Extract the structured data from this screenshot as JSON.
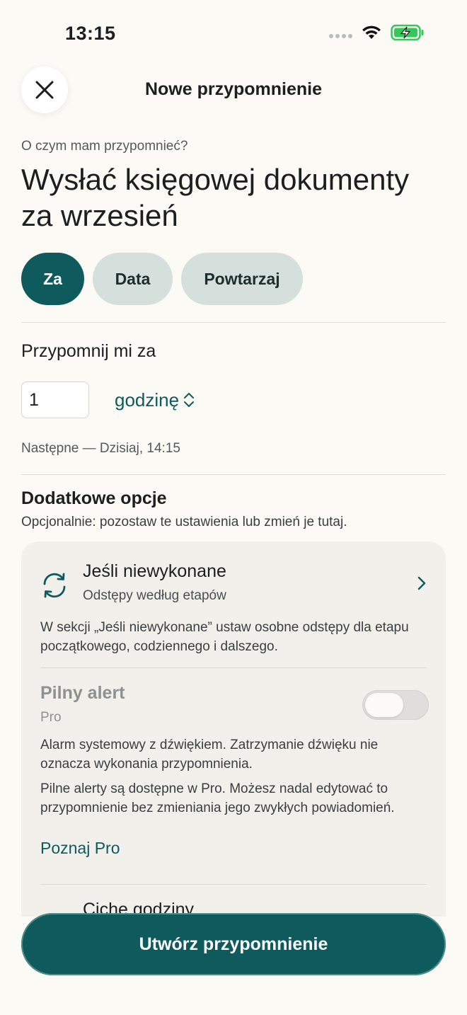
{
  "status_bar": {
    "time": "13:15"
  },
  "header": {
    "title": "Nowe przypomnienie"
  },
  "form": {
    "question_label": "O czym mam przypomnieć?",
    "reminder_text": "Wysłać księgowej dokumenty za wrzesień",
    "segments": [
      {
        "label": "Za",
        "active": true
      },
      {
        "label": "Data",
        "active": false
      },
      {
        "label": "Powtarzaj",
        "active": false
      }
    ],
    "remind_label": "Przypomnij mi za",
    "interval_value": "1",
    "interval_unit": "godzinę",
    "next_text": "Następne — Dzisiaj, 14:15"
  },
  "options": {
    "title": "Dodatkowe opcje",
    "subtitle": "Opcjonalnie: pozostaw te ustawienia lub zmień je tutaj.",
    "if_not_done": {
      "title": "Jeśli niewykonane",
      "subtitle": "Odstępy według etapów",
      "description": "W sekcji „Jeśli niewykonane” ustaw osobne odstępy dla etapu początkowego, codziennego i dalszego."
    },
    "urgent_alert": {
      "title": "Pilny alert",
      "badge": "Pro",
      "enabled": false,
      "description": "Alarm systemowy z dźwiękiem. Zatrzymanie dźwięku nie oznacza wykonania przypomnienia.",
      "pro_note": "Pilne alerty są dostępne w Pro. Możesz nadal edytować to przypomnienie bez zmieniania jego zwykłych powiadomień.",
      "pro_link": "Poznaj Pro"
    },
    "next_row_partial": "Ciche godziny"
  },
  "actions": {
    "create_label": "Utwórz przypomnienie"
  },
  "colors": {
    "accent": "#0f5a5c",
    "segment_inactive": "#d5e0dc",
    "background": "#fbfaf5",
    "battery": "#34c759"
  }
}
